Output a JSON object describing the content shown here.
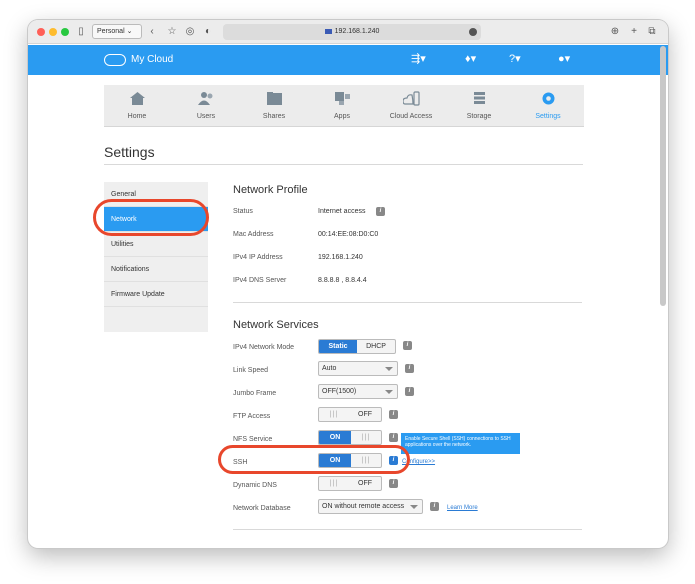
{
  "browser": {
    "profile": "Personal",
    "address": "192.168.1.240"
  },
  "app": {
    "brand": "My Cloud",
    "nav": [
      {
        "label": "Home",
        "icon": "home-icon"
      },
      {
        "label": "Users",
        "icon": "users-icon"
      },
      {
        "label": "Shares",
        "icon": "shares-folder-icon"
      },
      {
        "label": "Apps",
        "icon": "apps-icon"
      },
      {
        "label": "Cloud Access",
        "icon": "cloud-access-icon"
      },
      {
        "label": "Storage",
        "icon": "storage-icon"
      },
      {
        "label": "Settings",
        "icon": "gear-icon",
        "active": true
      }
    ]
  },
  "page": {
    "title": "Settings",
    "sidebar": [
      "General",
      "Network",
      "Utilities",
      "Notifications",
      "Firmware Update"
    ],
    "sidebar_active": "Network"
  },
  "profile": {
    "heading": "Network Profile",
    "rows": [
      {
        "label": "Status",
        "value": "Internet access"
      },
      {
        "label": "Mac Address",
        "value": "00:14:EE:08:D0:C0"
      },
      {
        "label": "IPv4 IP Address",
        "value": "192.168.1.240"
      },
      {
        "label": "IPv4 DNS Server",
        "value": "8.8.8.8 , 8.8.4.4"
      }
    ]
  },
  "services": {
    "heading": "Network Services",
    "ipv4_mode": {
      "label": "IPv4 Network Mode",
      "options": [
        "Static",
        "DHCP"
      ],
      "selected": "Static"
    },
    "link_speed": {
      "label": "Link Speed",
      "value": "Auto"
    },
    "jumbo_frame": {
      "label": "Jumbo Frame",
      "value": "OFF(1500)"
    },
    "ftp": {
      "label": "FTP Access",
      "state": "OFF"
    },
    "nfs": {
      "label": "NFS Service",
      "state": "ON"
    },
    "ssh": {
      "label": "SSH",
      "state": "ON",
      "configure": "Configure>>"
    },
    "ddns": {
      "label": "Dynamic DNS",
      "state": "OFF"
    },
    "network_db": {
      "label": "Network Database",
      "value": "ON without remote access",
      "learn_more": "Learn More"
    },
    "tooltip": "Enable Secure Shell (SSH) connections to SSH applications over the network.",
    "on_label": "ON",
    "off_label": "OFF",
    "grip": "|||"
  },
  "colors": {
    "accent": "#2a9bf1",
    "highlight": "#e8472c"
  }
}
